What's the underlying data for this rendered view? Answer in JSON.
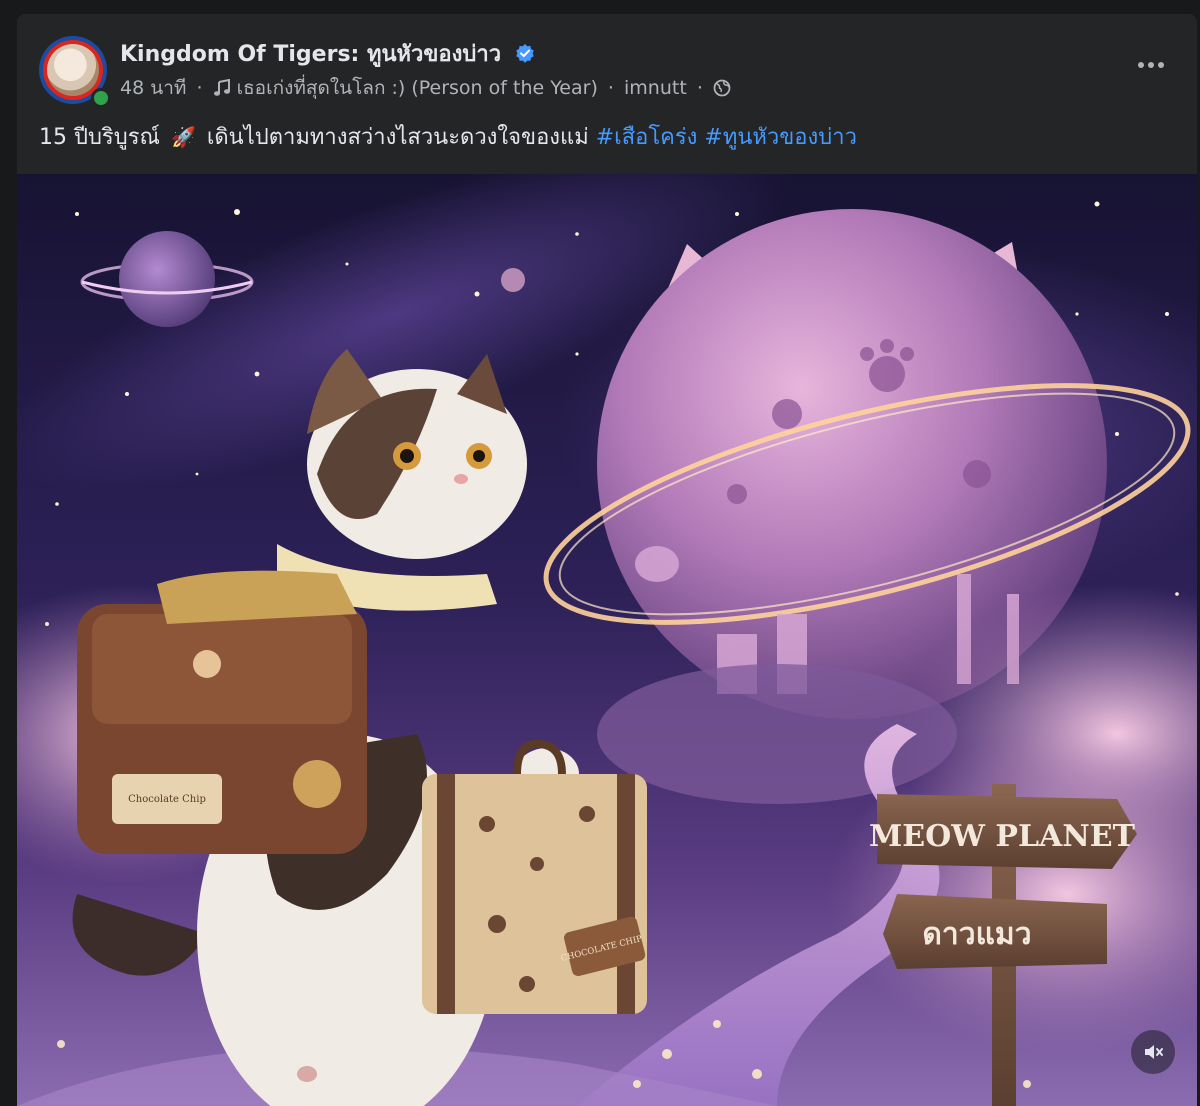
{
  "post": {
    "page_name": "Kingdom Of Tigers: ทูนหัวของบ่าว",
    "timestamp": "48 นาที",
    "music": "เธอเก่งที่สุดในโลก :) (Person of the Year)",
    "artist": "imnutt",
    "icons": {
      "verified": "verified-badge-icon",
      "music": "music-note-icon",
      "audience": "globe-icon",
      "more": "more-options-icon",
      "mute": "speaker-muted-icon"
    },
    "caption": {
      "text": "15 ปีบริบูรณ์",
      "emoji": "🚀",
      "body": "เดินไปตามทางสว่างไสวนะดวงใจของแม่",
      "hashtags": [
        "#เสือโคร่ง",
        "#ทูนหัวของบ่าว"
      ]
    }
  },
  "image": {
    "sign_top": "MEOW PLANET",
    "sign_bottom": "ดาวแมว",
    "bag_label": "Chocolate Chip",
    "suitcase_label": "CHOCOLATE CHIP"
  },
  "colors": {
    "accent_link": "#4599ff",
    "background": "#242526",
    "text_primary": "#e4e6eb",
    "text_secondary": "#b0b3b8",
    "online": "#31a24c"
  }
}
